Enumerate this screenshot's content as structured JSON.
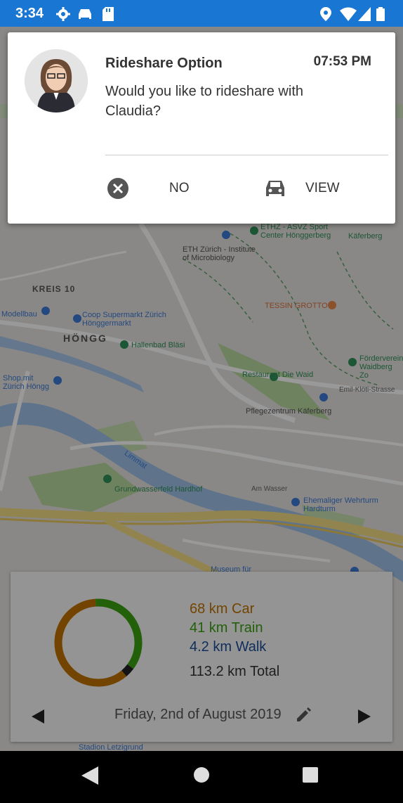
{
  "status_bar": {
    "time": "3:34",
    "left_icons": [
      "settings-icon",
      "car-icon",
      "sd-card-icon"
    ],
    "right_icons": [
      "location-icon",
      "wifi-icon",
      "signal-icon",
      "battery-icon"
    ]
  },
  "notification": {
    "title": "Rideshare Option",
    "time": "07:53 PM",
    "message": "Would you like to rideshare with Claudia?",
    "actions": [
      {
        "label": "NO",
        "icon": "close-circle-icon"
      },
      {
        "label": "VIEW",
        "icon": "car-icon"
      }
    ]
  },
  "map": {
    "labels": [
      "ETHZ - ASVZ Sport Center Hönggerberg",
      "Käferberg",
      "ETH Zürich - Institute of Microbiology",
      "KREIS 10",
      "Modellbau",
      "Coop Supermarkt Zürich Hönggermarkt",
      "TESSIN GROTTO",
      "HÖNGG",
      "Hallenbad Bläsi",
      "Förderverein Waidberg Zo",
      "Restaurant Die Waid",
      "Emil-Klöti-Strasse",
      "Pflegezentrum Käferberg",
      "Shop.mit Zürich Höngg",
      "Limmat",
      "Grundwasserfeld Hardhof",
      "Am Wasser",
      "Ehemaliger Wehrturm Hardturm",
      "Museum für",
      "Stadion Letzigrund"
    ]
  },
  "summary": {
    "car": "68 km Car",
    "train": "41 km Train",
    "walk": "4.2 km Walk",
    "total": "113.2 km Total",
    "date": "Friday, 2nd of August 2019",
    "colors": {
      "car": "#c07000",
      "train": "#3aa00f",
      "walk": "#1a4e9a",
      "other": "#222222"
    }
  },
  "chart_data": {
    "type": "pie",
    "categories": [
      "Car",
      "Train",
      "Walk"
    ],
    "values": [
      68,
      41,
      4.2
    ],
    "title": "",
    "total": 113.2
  },
  "nav": {
    "buttons": [
      "back-icon",
      "home-icon",
      "recents-icon"
    ]
  }
}
